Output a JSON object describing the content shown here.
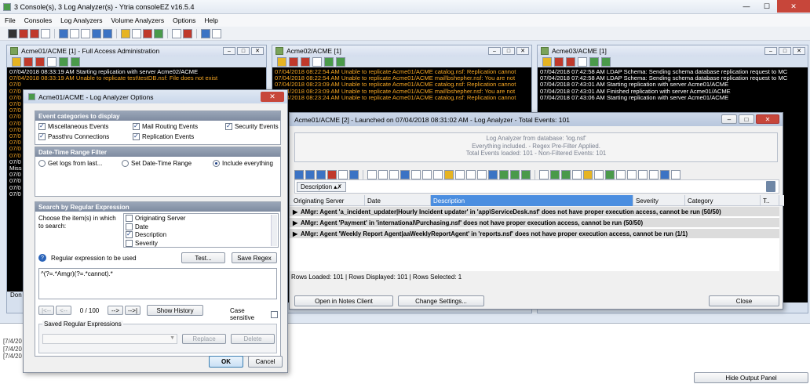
{
  "app": {
    "title": "3 Console(s), 3 Log Analyzer(s) - Ytria consoleEZ v16.5.4",
    "win_buttons": [
      "—",
      "☐",
      "✕"
    ]
  },
  "menu": [
    "File",
    "Consoles",
    "Log Analyzers",
    "Volume Analyzers",
    "Options",
    "Help"
  ],
  "pane_buttons": [
    "–",
    "□",
    "✕"
  ],
  "consoles": [
    {
      "title": "Acme01/ACME [1] - Full Access Administration",
      "lines": [
        {
          "t": "07/04/2018 08:33:19 AM  Starting replication with server Acme02/ACME",
          "c": "w"
        },
        {
          "t": "07/04/2018 08:33:19 AM  Unable to replicate test\\testDB.nsf: File does not exist",
          "c": "o"
        },
        {
          "t": "07/0",
          "c": "o"
        },
        {
          "t": "07/0",
          "c": "o"
        },
        {
          "t": "07/0",
          "c": "o"
        },
        {
          "t": "07/0",
          "c": "o"
        },
        {
          "t": "07/0",
          "c": "o"
        },
        {
          "t": "07/0",
          "c": "o"
        },
        {
          "t": "07/0",
          "c": "o"
        },
        {
          "t": "07/0",
          "c": "o"
        },
        {
          "t": "07/0",
          "c": "o"
        },
        {
          "t": "07/0",
          "c": "o"
        },
        {
          "t": "07/0",
          "c": "o"
        },
        {
          "t": "07/0",
          "c": "o"
        },
        {
          "t": "07/0",
          "c": "w"
        },
        {
          "t": "Miss",
          "c": "w"
        },
        {
          "t": "07/0",
          "c": "w"
        },
        {
          "t": "07/0",
          "c": "w"
        },
        {
          "t": "07/0",
          "c": "w"
        },
        {
          "t": "07/0",
          "c": "w"
        }
      ],
      "footer": "Don"
    },
    {
      "title": "Acme02/ACME [1]",
      "lines": [
        {
          "t": "07/04/2018 08:22:54 AM  Unable to replicate Acme01/ACME catalog.nsf: Replication cannot",
          "c": "o"
        },
        {
          "t": "07/04/2018 08:22:54 AM  Unable to replicate Acme01/ACME mail\\bshepher.nsf: You are not",
          "c": "o"
        },
        {
          "t": "07/04/2018 08:23:09 AM  Unable to replicate Acme01/ACME catalog.nsf: Replication cannot",
          "c": "o"
        },
        {
          "t": "07/04/2018 08:23:09 AM  Unable to replicate Acme01/ACME mail\\bshepher.nsf: You are not",
          "c": "o"
        },
        {
          "t": "07/04/2018 08:23:24 AM  Unable to replicate Acme01/ACME catalog.nsf: Replication cannot",
          "c": "o"
        }
      ]
    },
    {
      "title": "Acme03/ACME [1]",
      "lines": [
        {
          "t": "07/04/2018 07:42:58 AM  LDAP Schema: Sending schema database replication request to MC",
          "c": "w"
        },
        {
          "t": "07/04/2018 07:42:58 AM  LDAP Schema: Sending schema database replication request to MC",
          "c": "w"
        },
        {
          "t": "07/04/2018 07:43:01 AM  Starting replication with server Acme01/ACME",
          "c": "w"
        },
        {
          "t": "07/04/2018 07:43:01 AM  Finished replication with server Acme01/ACME",
          "c": "w"
        },
        {
          "t": "07/04/2018 07:43:06 AM  Starting replication with server Acme01/ACME",
          "c": "w"
        }
      ]
    }
  ],
  "analyzer": {
    "title": "Acme01/ACME [2] - Launched on 07/04/2018 08:31:02 AM - Log Analyzer - Total Events: 101",
    "info": [
      "Log Analyzer from database: 'log.nsf'",
      "Everything included. - Regex Pre-Filter Applied.",
      "Total Events loaded: 101 - Non-Filtered Events: 101"
    ],
    "group_chip": "Description",
    "columns": [
      "Originating Server",
      "Date",
      "Description",
      "Severity",
      "Category",
      "T.."
    ],
    "rows": [
      "AMgr: Agent 'a_incident_updater|Hourly Incident updater' in 'app\\ServiceDesk.nsf' does not have proper execution access, cannot be run (50/50)",
      "AMgr: Agent 'Payment' in 'international\\Purchasing.nsf' does not have proper execution access, cannot be run (50/50)",
      "AMgr: Agent 'Weekly Report Agent|aaWeeklyReportAgent' in 'reports.nsf' does not have proper execution access, cannot be run (1/1)"
    ],
    "status": "Rows Loaded: 101  |  Rows Displayed: 101  |  Rows Selected: 1",
    "btn_open": "Open in Notes Client",
    "btn_settings": "Change Settings...",
    "btn_close": "Close"
  },
  "options": {
    "title": "Acme01/ACME - Log Analyzer Options",
    "events_head": "Event categories to display",
    "events": [
      {
        "l": "Miscellaneous Events",
        "on": true
      },
      {
        "l": "Mail Routing Events",
        "on": true
      },
      {
        "l": "Security Events",
        "on": true
      },
      {
        "l": "Passthru Connections",
        "on": true
      },
      {
        "l": "Replication Events",
        "on": true
      }
    ],
    "date_head": "Date-Time Range Filter",
    "date_opts": [
      {
        "l": "Get logs from last...",
        "on": false
      },
      {
        "l": "Set Date-Time Range",
        "on": false
      },
      {
        "l": "Include everything",
        "on": true
      }
    ],
    "regex_head": "Search by Regular Expression",
    "choose_label": "Choose the item(s) in which to search:",
    "items": [
      {
        "l": "Originating Server",
        "on": false
      },
      {
        "l": "Date",
        "on": false
      },
      {
        "l": "Description",
        "on": true
      },
      {
        "l": "Severity",
        "on": false
      }
    ],
    "regex_label": "Regular expression to be used",
    "test_btn": "Test...",
    "save_regex_btn": "Save Regex",
    "regex_value": "^(?=.*Amgr)(?=.*cannot).*",
    "counter": "0 / 100",
    "nav": [
      "|<--",
      "<--",
      "-->",
      "-->|"
    ],
    "history_btn": "Show History",
    "case_label": "Case sensitive",
    "saved_head": "Saved Regular Expressions",
    "replace_btn": "Replace",
    "delete_btn": "Delete",
    "ok_btn": "OK",
    "cancel_btn": "Cancel"
  },
  "output": {
    "lines": [
      "[7/4/20",
      "[7/4/20",
      "[7/4/20"
    ],
    "hide_btn": "Hide Output Panel"
  }
}
